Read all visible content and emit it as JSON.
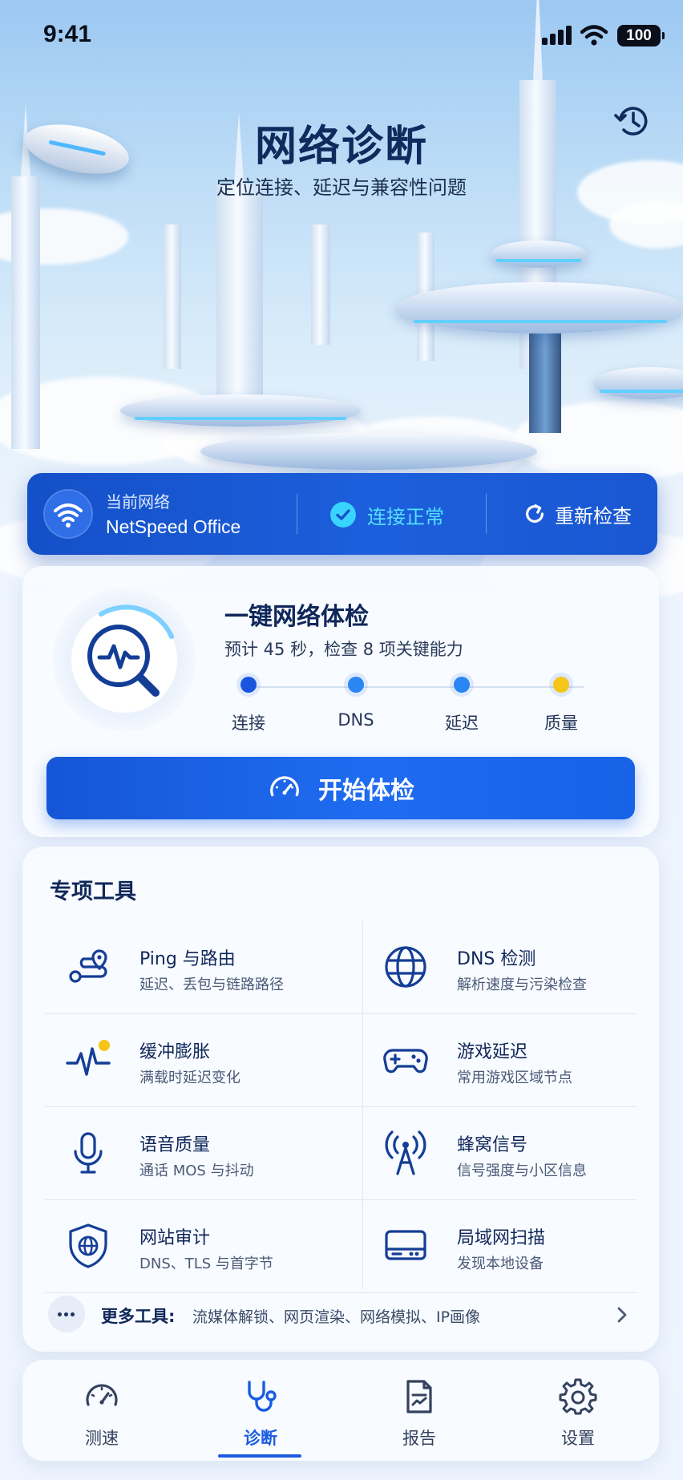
{
  "status_bar": {
    "time": "9:41",
    "battery": "100"
  },
  "header": {
    "title": "网络诊断",
    "subtitle": "定位连接、延迟与兼容性问题",
    "history_icon": "history-icon"
  },
  "network": {
    "label": "当前网络",
    "name": "NetSpeed Office",
    "status": "连接正常",
    "recheck": "重新检查",
    "status_color": "#55e0ff"
  },
  "checkup": {
    "title": "一键网络体检",
    "subtitle": "预计 45 秒，检查 8 项关键能力",
    "steps": [
      {
        "label": "连接",
        "color": "#1a55e0"
      },
      {
        "label": "DNS",
        "color": "#2a86f2"
      },
      {
        "label": "延迟",
        "color": "#2a86f2"
      },
      {
        "label": "质量",
        "color": "#f5c518"
      }
    ],
    "start_button": "开始体检"
  },
  "tools": {
    "heading": "专项工具",
    "items": [
      {
        "title": "Ping 与路由",
        "desc": "延迟、丢包与链路路径",
        "icon": "route-icon"
      },
      {
        "title": "DNS 检测",
        "desc": "解析速度与污染检查",
        "icon": "globe-icon"
      },
      {
        "title": "缓冲膨胀",
        "desc": "满载时延迟变化",
        "icon": "pulse-icon"
      },
      {
        "title": "游戏延迟",
        "desc": "常用游戏区域节点",
        "icon": "gamepad-icon"
      },
      {
        "title": "语音质量",
        "desc": "通话 MOS 与抖动",
        "icon": "microphone-icon"
      },
      {
        "title": "蜂窝信号",
        "desc": "信号强度与小区信息",
        "icon": "cell-tower-icon"
      },
      {
        "title": "网站审计",
        "desc": "DNS、TLS 与首字节",
        "icon": "shield-globe-icon"
      },
      {
        "title": "局域网扫描",
        "desc": "发现本地设备",
        "icon": "router-icon"
      }
    ],
    "more_label": "更多工具:",
    "more_text": "流媒体解锁、网页渲染、网络模拟、IP画像"
  },
  "tabbar": {
    "tabs": [
      {
        "label": "测速",
        "icon": "speedometer-icon"
      },
      {
        "label": "诊断",
        "icon": "stethoscope-icon"
      },
      {
        "label": "报告",
        "icon": "report-icon"
      },
      {
        "label": "设置",
        "icon": "gear-icon"
      }
    ],
    "active_index": 1,
    "accent": "#1a5ce0"
  }
}
